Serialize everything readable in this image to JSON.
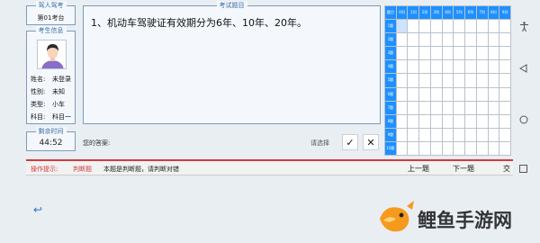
{
  "seat": {
    "title": "驾人驾考",
    "value": "第01考台"
  },
  "examinee": {
    "title": "考生信息",
    "rows": [
      {
        "label": "姓名:",
        "value": "未登录"
      },
      {
        "label": "性别:",
        "value": "未知"
      },
      {
        "label": "类型:",
        "value": "小车"
      },
      {
        "label": "科目:",
        "value": "科目一"
      }
    ]
  },
  "timer": {
    "title": "剩余时间",
    "value": "44:52"
  },
  "question": {
    "title": "考试题目",
    "text": "1、机动车驾驶证有效期分为6年、10年、20年。"
  },
  "answer": {
    "label": "您的答案:",
    "prompt": "请选择",
    "true_label": "✓",
    "false_label": "✕"
  },
  "grid": {
    "corner": "题目",
    "columns": [
      "0列",
      "1列",
      "2列",
      "3列",
      "4列",
      "5列",
      "6列",
      "7列",
      "8列",
      "9列"
    ],
    "rows": [
      "1题",
      "2题",
      "3题",
      "4题",
      "5题",
      "6题",
      "7题",
      "8题",
      "9题",
      "10题"
    ],
    "current_row": 0
  },
  "status": {
    "tip_label": "操作提示:",
    "type": "判断题",
    "message": "本题是判断题，请判断对错",
    "prev_label": "上一题",
    "next_label": "下一题",
    "extra_label": "交"
  },
  "colors": {
    "accent": "#1e90ff",
    "frame": "#7d9bbb",
    "status_line": "#d33b3b"
  },
  "watermark": {
    "text": "鲤鱼手游网"
  }
}
